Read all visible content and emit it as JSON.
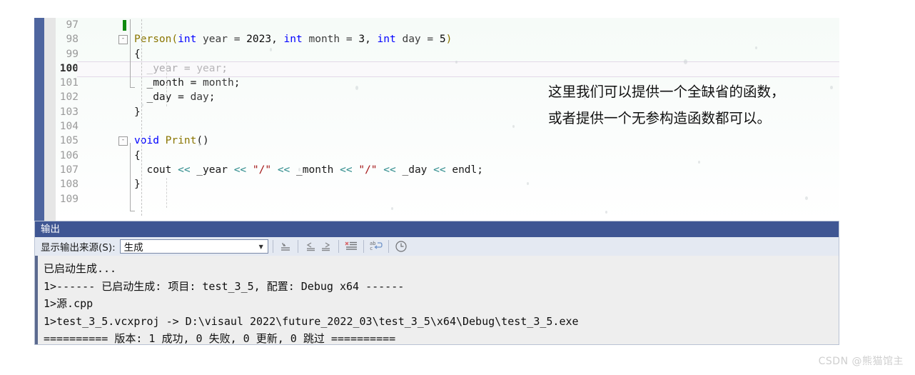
{
  "editor": {
    "lines": [
      {
        "num": "97",
        "current": false,
        "fold": null,
        "marker": "green",
        "tokens": []
      },
      {
        "num": "98",
        "current": false,
        "fold": "-",
        "marker": null,
        "tokens": [
          {
            "t": "Person(",
            "c": "cls"
          },
          {
            "t": "int",
            "c": "k"
          },
          {
            "t": " year = ",
            "c": "id"
          },
          {
            "t": "2023",
            "c": "num"
          },
          {
            "t": ", ",
            "c": "pl"
          },
          {
            "t": "int",
            "c": "k"
          },
          {
            "t": " month = ",
            "c": "id"
          },
          {
            "t": "3",
            "c": "num"
          },
          {
            "t": ", ",
            "c": "pl"
          },
          {
            "t": "int",
            "c": "k"
          },
          {
            "t": " day = ",
            "c": "id"
          },
          {
            "t": "5",
            "c": "num"
          },
          {
            "t": ")",
            "c": "cls"
          }
        ]
      },
      {
        "num": "99",
        "current": false,
        "fold": null,
        "marker": null,
        "tokens": [
          {
            "t": "{",
            "c": "pl"
          }
        ]
      },
      {
        "num": "100",
        "current": true,
        "fold": null,
        "marker": null,
        "tokens": [
          {
            "t": "  _year = ",
            "c": "pl"
          },
          {
            "t": "year",
            "c": "id"
          },
          {
            "t": ";",
            "c": "pl"
          }
        ]
      },
      {
        "num": "101",
        "current": false,
        "fold": null,
        "marker": null,
        "tokens": [
          {
            "t": "  _month = ",
            "c": "pl"
          },
          {
            "t": "month",
            "c": "id"
          },
          {
            "t": ";",
            "c": "pl"
          }
        ]
      },
      {
        "num": "102",
        "current": false,
        "fold": null,
        "marker": null,
        "tokens": [
          {
            "t": "  _day = ",
            "c": "pl"
          },
          {
            "t": "day",
            "c": "id"
          },
          {
            "t": ";",
            "c": "pl"
          }
        ]
      },
      {
        "num": "103",
        "current": false,
        "fold": null,
        "marker": null,
        "tokens": [
          {
            "t": "}",
            "c": "pl"
          }
        ]
      },
      {
        "num": "104",
        "current": false,
        "fold": null,
        "marker": null,
        "tokens": []
      },
      {
        "num": "105",
        "current": false,
        "fold": "-",
        "marker": null,
        "tokens": [
          {
            "t": "void",
            "c": "k"
          },
          {
            "t": " ",
            "c": "pl"
          },
          {
            "t": "Print",
            "c": "cls"
          },
          {
            "t": "()",
            "c": "pl"
          }
        ]
      },
      {
        "num": "106",
        "current": false,
        "fold": null,
        "marker": null,
        "tokens": [
          {
            "t": "{",
            "c": "pl"
          }
        ]
      },
      {
        "num": "107",
        "current": false,
        "fold": null,
        "marker": null,
        "tokens": [
          {
            "t": "  cout ",
            "c": "pl"
          },
          {
            "t": "<<",
            "c": "op"
          },
          {
            "t": " _year ",
            "c": "pl"
          },
          {
            "t": "<<",
            "c": "op"
          },
          {
            "t": " ",
            "c": "pl"
          },
          {
            "t": "\"/\"",
            "c": "str"
          },
          {
            "t": " ",
            "c": "pl"
          },
          {
            "t": "<<",
            "c": "op"
          },
          {
            "t": " _month ",
            "c": "pl"
          },
          {
            "t": "<<",
            "c": "op"
          },
          {
            "t": " ",
            "c": "pl"
          },
          {
            "t": "\"/\"",
            "c": "str"
          },
          {
            "t": " ",
            "c": "pl"
          },
          {
            "t": "<<",
            "c": "op"
          },
          {
            "t": " _day ",
            "c": "pl"
          },
          {
            "t": "<<",
            "c": "op"
          },
          {
            "t": " endl;",
            "c": "pl"
          }
        ]
      },
      {
        "num": "108",
        "current": false,
        "fold": null,
        "marker": null,
        "tokens": [
          {
            "t": "}",
            "c": "pl"
          }
        ]
      },
      {
        "num": "109",
        "current": false,
        "fold": null,
        "marker": null,
        "tokens": []
      }
    ]
  },
  "annotation": {
    "line1": "这里我们可以提供一个全缺省的函数，",
    "line2": "或者提供一个无参构造函数都可以。"
  },
  "output": {
    "title": "输出",
    "source_label": "显示输出来源(S):",
    "source_value": "生成",
    "toolbar_icons": [
      "jump-to-source-icon",
      "navigate-back-icon",
      "navigate-forward-icon",
      "clear-all-icon",
      "toggle-word-wrap-icon",
      "show-timestamps-icon"
    ],
    "lines": [
      "已启动生成...",
      "1>------ 已启动生成: 项目: test_3_5, 配置: Debug x64 ------",
      "1>源.cpp",
      "1>test_3_5.vcxproj -> D:\\visaul 2022\\future_2022_03\\test_3_5\\x64\\Debug\\test_3_5.exe",
      "========== 版本: 1 成功, 0 失败, 0 更新, 0 跳过 =========="
    ]
  },
  "watermark": {
    "text": "CSDN @熊猫馆主"
  },
  "colors": {
    "accent_blue": "#4e659f",
    "title_bar": "#3f5693",
    "keyword": "#0000ff",
    "class_name": "#8a7500",
    "string": "#a31515",
    "operator": "#2b8a8a",
    "breakpoint_green": "#108a10"
  }
}
